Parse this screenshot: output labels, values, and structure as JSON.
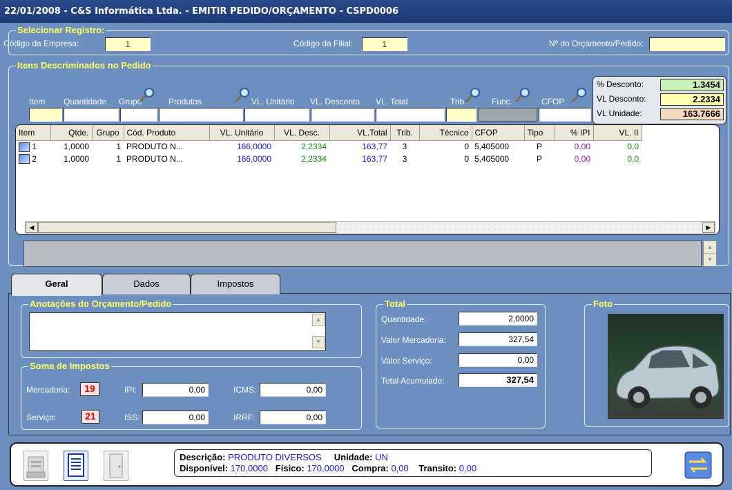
{
  "window": {
    "title": "22/01/2008  -  C&S Informática Ltda.  -  EMITIR PEDIDO/ORÇAMENTO  -  CSPD0006"
  },
  "selecionar": {
    "title": "Selecionar Registro:",
    "empresa_label": "Código da Empresa:",
    "empresa_value": "1",
    "filial_label": "Código da Filial:",
    "filial_value": "1",
    "orcamento_label": "Nº do Orçamento/Pedido:",
    "orcamento_value": ""
  },
  "itens": {
    "title": "Itens Descriminados no Pedido",
    "headers": {
      "item": "Item",
      "quantidade": "Quantidade",
      "grupo": "Grupo",
      "produtos": "Produtos",
      "vl_unitario": "VL. Unitário",
      "vl_desconto": "VL. Desconto",
      "vl_total": "VL. Total",
      "trib": "Trib.",
      "func": "Func.",
      "cfop": "CFOP"
    },
    "summary": {
      "desconto_label": "% Desconto:",
      "desconto_value": "1.3454",
      "vl_desconto_label": "VL Desconto:",
      "vl_desconto_value": "2.2334",
      "vl_unidade_label": "VL Unidade:",
      "vl_unidade_value": "163.7666"
    }
  },
  "grid": {
    "columns": [
      "Item",
      "Qtde.",
      "Grupo",
      "Cód. Produto",
      "VL. Unitário",
      "VL. Desc.",
      "VL.Total",
      "Trib.",
      "Técnico",
      "CFOP",
      "Tipo",
      "% IPI",
      "VL. II"
    ],
    "rows": [
      [
        "1",
        "1,0000",
        "1",
        "PRODUTO N...",
        "166,0000",
        "2,2334",
        "163,77",
        "3",
        "0",
        "5,405000",
        "P",
        "0,00",
        "0,0"
      ],
      [
        "2",
        "1,0000",
        "1",
        "PRODUTO N...",
        "166,0000",
        "2,2334",
        "163,77",
        "3",
        "0",
        "5,405000",
        "P",
        "0,00",
        "0,0"
      ]
    ]
  },
  "tabs": [
    {
      "label": "Geral"
    },
    {
      "label": "Dados"
    },
    {
      "label": "Impostos"
    }
  ],
  "anotacoes": {
    "title": "Anotações do Orçamento/Pedido"
  },
  "impostos": {
    "title": "Soma de Impostos",
    "mercadoria_label": "Mercadoria:",
    "mercadoria_value": "19",
    "servico_label": "Serviço:",
    "servico_value": "21",
    "ipi_label": "IPI:",
    "ipi_value": "0,00",
    "iss_label": "ISS:",
    "iss_value": "0,00",
    "icms_label": "ICMS:",
    "icms_value": "0,00",
    "irrf_label": "IRRF:",
    "irrf_value": "0,00"
  },
  "total": {
    "title": "Total",
    "quantidade_label": "Quantidade:",
    "quantidade_value": "2,0000",
    "mercadoria_label": "Valor Mercadoria:",
    "mercadoria_value": "327,54",
    "servico_label": "Valor Serviço:",
    "servico_value": "0,00",
    "acumulado_label": "Total Acumulado:",
    "acumulado_value": "327,54"
  },
  "foto": {
    "title": "Foto"
  },
  "status": {
    "descricao_label": "Descrição:",
    "descricao_value": "PRODUTO DIVERSOS",
    "unidade_label": "Unidade:",
    "unidade_value": "UN",
    "disponivel_label": "Disponível:",
    "disponivel_value": "170,0000",
    "fisico_label": "Físico:",
    "fisico_value": "170,0000",
    "compra_label": "Compra:",
    "compra_value": "0,00",
    "transito_label": "Transito:",
    "transito_value": "0,00"
  },
  "colors": {
    "background": "#6d8fbf",
    "accent_title": "#ffff66",
    "titlebar": "#1d3a78"
  }
}
